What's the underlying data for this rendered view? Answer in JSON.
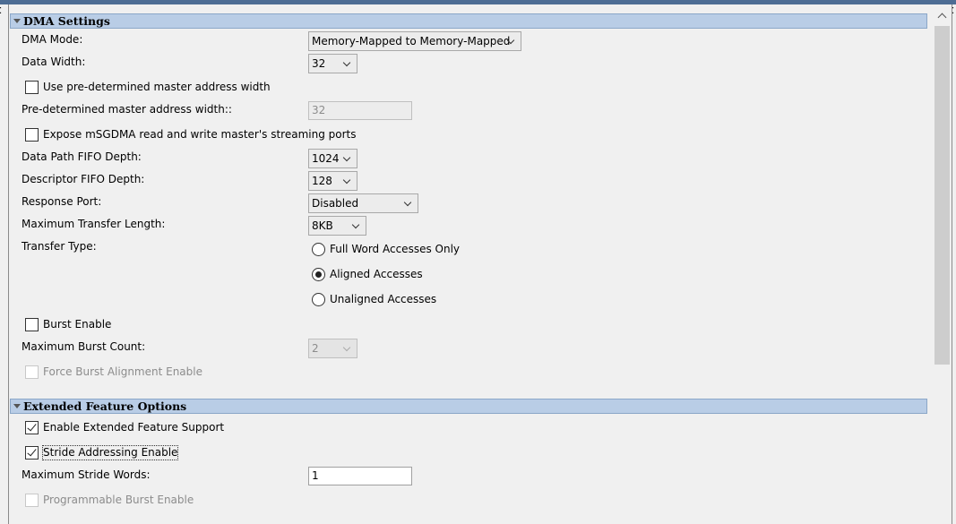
{
  "dma_settings": {
    "title": "DMA Settings",
    "dma_mode": {
      "label": "DMA Mode:",
      "value": "Memory-Mapped to Memory-Mapped"
    },
    "data_width": {
      "label": "Data Width:",
      "value": "32"
    },
    "use_predetermined": {
      "label": "Use pre-determined master address width",
      "checked": false
    },
    "predetermined_width": {
      "label": "Pre-determined master address width::",
      "value": "32"
    },
    "expose_ports": {
      "label": "Expose mSGDMA read and write master's streaming ports",
      "checked": false
    },
    "data_path_fifo": {
      "label": "Data Path FIFO Depth:",
      "value": "1024"
    },
    "descriptor_fifo": {
      "label": "Descriptor FIFO Depth:",
      "value": "128"
    },
    "response_port": {
      "label": "Response Port:",
      "value": "Disabled"
    },
    "max_transfer_length": {
      "label": "Maximum Transfer Length:",
      "value": "8KB"
    },
    "transfer_type": {
      "label": "Transfer Type:",
      "options": [
        "Full Word Accesses Only",
        "Aligned Accesses",
        "Unaligned Accesses"
      ],
      "selected": "Aligned Accesses"
    },
    "burst_enable": {
      "label": "Burst Enable",
      "checked": false
    },
    "max_burst_count": {
      "label": "Maximum Burst Count:",
      "value": "2"
    },
    "force_burst_alignment": {
      "label": "Force Burst Alignment Enable",
      "checked": false
    }
  },
  "extended_features": {
    "title": "Extended Feature Options",
    "enable_extended": {
      "label": "Enable Extended Feature Support",
      "checked": true
    },
    "stride_addressing": {
      "label": "Stride Addressing Enable",
      "checked": true
    },
    "max_stride_words": {
      "label": "Maximum Stride Words:",
      "value": "1"
    },
    "programmable_burst": {
      "label": "Programmable Burst Enable",
      "checked": false
    }
  },
  "icons": {
    "collapse": "triangle-down-icon",
    "dropdown": "chevron-down-icon",
    "check": "checkmark-icon",
    "scroll_up": "chevron-up-icon"
  },
  "colors": {
    "section_header": "#b9cde6",
    "title_bar": "#4d6d94",
    "background": "#f0f0f0"
  }
}
